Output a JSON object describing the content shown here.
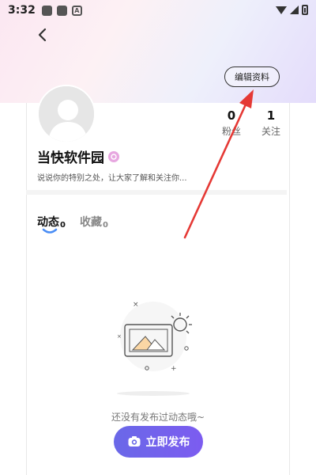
{
  "status_bar": {
    "time": "3:32"
  },
  "header": {
    "edit_label": "编辑资料"
  },
  "profile": {
    "fans_count": "0",
    "fans_label": "粉丝",
    "follow_count": "1",
    "follow_label": "关注",
    "username": "当快软件园",
    "bio": "说说你的特别之处，让大家了解和关注你..."
  },
  "tabs": [
    {
      "label": "动态",
      "count": "0",
      "active": true
    },
    {
      "label": "收藏",
      "count": "0",
      "active": false
    }
  ],
  "empty_state": {
    "message": "还没有发布过动态哦~",
    "publish_label": "立即发布"
  },
  "colors": {
    "accent": "#6a68e8",
    "arrow": "#e53935",
    "vip": "#e7a7e0"
  }
}
